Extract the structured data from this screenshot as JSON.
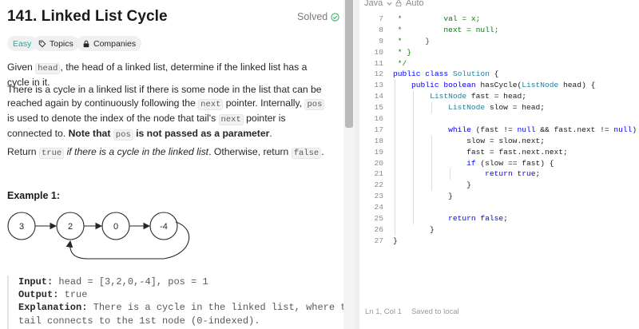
{
  "problem": {
    "title": "141. Linked List Cycle",
    "status": "Solved",
    "tags": {
      "difficulty": "Easy",
      "topics": "Topics",
      "companies": "Companies"
    },
    "p1": {
      "t1": "Given ",
      "c1": "head",
      "t2": ", the head of a linked list, determine if the linked list has a cycle in it."
    },
    "p2": {
      "t1": "There is a cycle in a linked list if there is some node in the list that can be reached again by following continuously following the ",
      "t1_real": "There is a cycle in a linked list if there is some node in the list that can be reached again by continuously following the ",
      "c1": "next",
      "t2": " pointer. Internally, ",
      "c2": "pos",
      "t3": " is used to denote the index of the node that tail's ",
      "c3": "next",
      "t4": " pointer is connected to. ",
      "b1": "Note that ",
      "c4": "pos",
      "b2": " is not passed as a parameter",
      "t5": "."
    },
    "p3": {
      "t1": "Return ",
      "c1": "true",
      "i1": " if there is a cycle in the linked list",
      "t2": ". Otherwise, return ",
      "c2": "false",
      "t3": "."
    },
    "example_title": "Example 1:",
    "diagram_nodes": [
      "3",
      "2",
      "0",
      "-4"
    ],
    "example": {
      "input_label": "Input:",
      "input_value": " head = [3,2,0,-4], pos = 1",
      "output_label": "Output:",
      "output_value": " true",
      "explanation_label": "Explanation:",
      "explanation_line1": " There is a cycle in the linked list, where the",
      "explanation_line2": "tail connects to the 1st node (0-indexed)."
    }
  },
  "editor": {
    "language": "Java",
    "mode": "Auto",
    "status_position": "Ln 1, Col 1",
    "status_saved": "Saved to local",
    "lines": [
      {
        "n": "7",
        "indent": 0,
        "guides": [],
        "segs": [
          [
            "cm",
            " *         val = x;"
          ]
        ]
      },
      {
        "n": "8",
        "indent": 0,
        "guides": [],
        "segs": [
          [
            "cm",
            " *         next = null;"
          ]
        ]
      },
      {
        "n": "9",
        "indent": 0,
        "guides": [],
        "segs": [
          [
            "cm",
            " *     }"
          ]
        ]
      },
      {
        "n": "10",
        "indent": 0,
        "guides": [],
        "segs": [
          [
            "cm",
            " * }"
          ]
        ]
      },
      {
        "n": "11",
        "indent": 0,
        "guides": [],
        "segs": [
          [
            "cm",
            " */"
          ]
        ]
      },
      {
        "n": "12",
        "indent": 0,
        "guides": [],
        "segs": [
          [
            "kw",
            "public class "
          ],
          [
            "ty",
            "Solution"
          ],
          [
            "",
            " {"
          ]
        ]
      },
      {
        "n": "13",
        "indent": 0,
        "guides": [
          1
        ],
        "segs": [
          [
            "",
            "    "
          ],
          [
            "kw",
            "public boolean "
          ],
          [
            "",
            "hasCycle("
          ],
          [
            "ty",
            "ListNode"
          ],
          [
            "",
            " head) {"
          ]
        ]
      },
      {
        "n": "14",
        "indent": 0,
        "guides": [
          1,
          2
        ],
        "segs": [
          [
            "",
            "        "
          ],
          [
            "ty",
            "ListNode"
          ],
          [
            "",
            " fast = head;"
          ]
        ]
      },
      {
        "n": "15",
        "indent": 0,
        "guides": [
          1,
          2,
          3
        ],
        "segs": [
          [
            "",
            "            "
          ],
          [
            "ty",
            "ListNode"
          ],
          [
            "",
            " slow = head;"
          ]
        ]
      },
      {
        "n": "16",
        "indent": 0,
        "guides": [
          1,
          2
        ],
        "segs": [
          [
            "",
            ""
          ]
        ]
      },
      {
        "n": "17",
        "indent": 0,
        "guides": [
          1,
          2
        ],
        "segs": [
          [
            "",
            "            "
          ],
          [
            "kw",
            "while"
          ],
          [
            "",
            " (fast != "
          ],
          [
            "kw",
            "null"
          ],
          [
            "",
            " && fast.next != "
          ],
          [
            "kw",
            "null"
          ],
          [
            "",
            ") {"
          ]
        ]
      },
      {
        "n": "18",
        "indent": 0,
        "guides": [
          1,
          2,
          3
        ],
        "segs": [
          [
            "",
            "                slow = slow.next;"
          ]
        ]
      },
      {
        "n": "19",
        "indent": 0,
        "guides": [
          1,
          2,
          3
        ],
        "segs": [
          [
            "",
            "                fast = fast.next.next;"
          ]
        ]
      },
      {
        "n": "20",
        "indent": 0,
        "guides": [
          1,
          2,
          3
        ],
        "segs": [
          [
            "",
            "                "
          ],
          [
            "kw",
            "if"
          ],
          [
            "",
            " (slow == fast) {"
          ]
        ]
      },
      {
        "n": "21",
        "indent": 0,
        "guides": [
          1,
          2,
          3,
          4
        ],
        "segs": [
          [
            "",
            "                    "
          ],
          [
            "kw",
            "return true"
          ],
          [
            "",
            ";"
          ]
        ]
      },
      {
        "n": "22",
        "indent": 0,
        "guides": [
          1,
          2,
          3
        ],
        "segs": [
          [
            "",
            "                }"
          ]
        ]
      },
      {
        "n": "23",
        "indent": 0,
        "guides": [
          1,
          2
        ],
        "segs": [
          [
            "",
            "            }"
          ]
        ]
      },
      {
        "n": "24",
        "indent": 0,
        "guides": [
          1,
          2
        ],
        "segs": [
          [
            "",
            ""
          ]
        ]
      },
      {
        "n": "25",
        "indent": 0,
        "guides": [
          1,
          2
        ],
        "segs": [
          [
            "",
            "            "
          ],
          [
            "kw",
            "return false"
          ],
          [
            "",
            ";"
          ]
        ]
      },
      {
        "n": "26",
        "indent": 0,
        "guides": [
          1
        ],
        "segs": [
          [
            "",
            "        }"
          ]
        ]
      },
      {
        "n": "27",
        "indent": 0,
        "guides": [],
        "segs": [
          [
            "",
            "}"
          ]
        ]
      }
    ]
  }
}
